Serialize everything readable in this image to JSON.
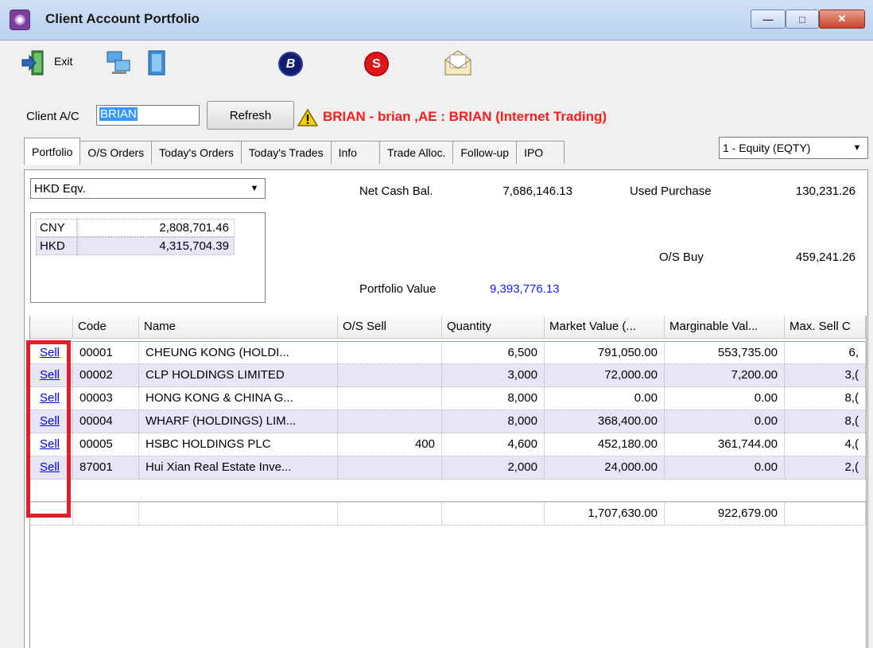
{
  "window": {
    "title": "Client Account Portfolio",
    "min_label": "—",
    "max_label": "□",
    "close_label": "✕"
  },
  "toolbar": {
    "exit_label": "Exit",
    "buy_glyph": "B",
    "sell_glyph": "S"
  },
  "client": {
    "label": "Client A/C",
    "value": "BRIAN",
    "refresh_label": "Refresh",
    "status_text": "BRIAN - brian ,AE : BRIAN (Internet Trading)"
  },
  "tabs": [
    {
      "label": "Portfolio",
      "active": true
    },
    {
      "label": "O/S Orders"
    },
    {
      "label": "Today's Orders"
    },
    {
      "label": "Today's Trades"
    },
    {
      "label": "Info"
    },
    {
      "label": "Trade Alloc."
    },
    {
      "label": "Follow-up"
    },
    {
      "label": "IPO"
    }
  ],
  "market_select": {
    "value": "1 - Equity (EQTY)"
  },
  "currency_select": {
    "value": "HKD Eqv."
  },
  "currencies": [
    {
      "code": "CNY",
      "amount": "2,808,701.46"
    },
    {
      "code": "HKD",
      "amount": "4,315,704.39"
    }
  ],
  "summary": {
    "net_cash_label": "Net Cash Bal.",
    "net_cash_value": "7,686,146.13",
    "used_purchase_label": "Used Purchase",
    "used_purchase_value": "130,231.26",
    "os_buy_label": "O/S Buy",
    "os_buy_value": "459,241.26",
    "portfolio_value_label": "Portfolio Value",
    "portfolio_value_value": "9,393,776.13"
  },
  "grid": {
    "columns": [
      "",
      "Code",
      "Name",
      "O/S Sell",
      "Quantity",
      "Market Value (...",
      "Marginable Val...",
      "Max. Sell C"
    ],
    "rows": [
      {
        "action": "Sell",
        "code": "00001",
        "name": "CHEUNG KONG (HOLDI...",
        "os_sell": "",
        "quantity": "6,500",
        "market_value": "791,050.00",
        "marginable": "553,735.00",
        "max_sell": "6,"
      },
      {
        "action": "Sell",
        "code": "00002",
        "name": "CLP HOLDINGS LIMITED",
        "os_sell": "",
        "quantity": "3,000",
        "market_value": "72,000.00",
        "marginable": "7,200.00",
        "max_sell": "3,("
      },
      {
        "action": "Sell",
        "code": "00003",
        "name": "HONG KONG & CHINA G...",
        "os_sell": "",
        "quantity": "8,000",
        "market_value": "0.00",
        "marginable": "0.00",
        "max_sell": "8,("
      },
      {
        "action": "Sell",
        "code": "00004",
        "name": "WHARF (HOLDINGS) LIM...",
        "os_sell": "",
        "quantity": "8,000",
        "market_value": "368,400.00",
        "marginable": "0.00",
        "max_sell": "8,("
      },
      {
        "action": "Sell",
        "code": "00005",
        "name": "HSBC HOLDINGS PLC",
        "os_sell": "400",
        "quantity": "4,600",
        "market_value": "452,180.00",
        "marginable": "361,744.00",
        "max_sell": "4,("
      },
      {
        "action": "Sell",
        "code": "87001",
        "name": "Hui Xian Real Estate Inve...",
        "os_sell": "",
        "quantity": "2,000",
        "market_value": "24,000.00",
        "marginable": "0.00",
        "max_sell": "2,("
      }
    ],
    "totals": {
      "market_value": "1,707,630.00",
      "marginable": "922,679.00"
    }
  },
  "colors": {
    "warning_red": "#ff1a1a",
    "portfolio_value_blue": "#1a1aff",
    "row_alt": "#e6e6f8",
    "highlight_box": "#e11f26"
  },
  "icons": [
    "app-icon",
    "exit-icon",
    "network-icon",
    "book-icon",
    "buy-icon",
    "sell-icon",
    "mail-icon",
    "warning-icon",
    "dropdown-arrow-icon"
  ]
}
